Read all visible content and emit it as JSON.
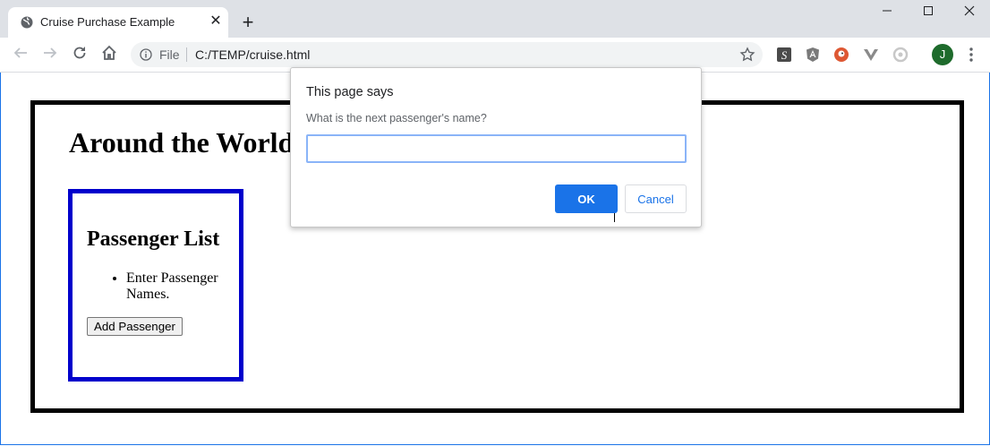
{
  "browser": {
    "tab_title": "Cruise Purchase Example",
    "tab_favicon": "globe-icon",
    "omnibox_scheme": "File",
    "omnibox_url": "C:/TEMP/cruise.html",
    "avatar_letter": "J",
    "accent_color": "#1a73e8"
  },
  "page": {
    "title": "Around the World",
    "passenger_panel": {
      "heading": "Passenger List",
      "items": [
        "Enter Passenger Names."
      ],
      "add_button_label": "Add Passenger",
      "border_color": "#0000cc"
    }
  },
  "dialog": {
    "title": "This page says",
    "message": "What is the next passenger's name?",
    "input_value": "",
    "ok_label": "OK",
    "cancel_label": "Cancel"
  }
}
